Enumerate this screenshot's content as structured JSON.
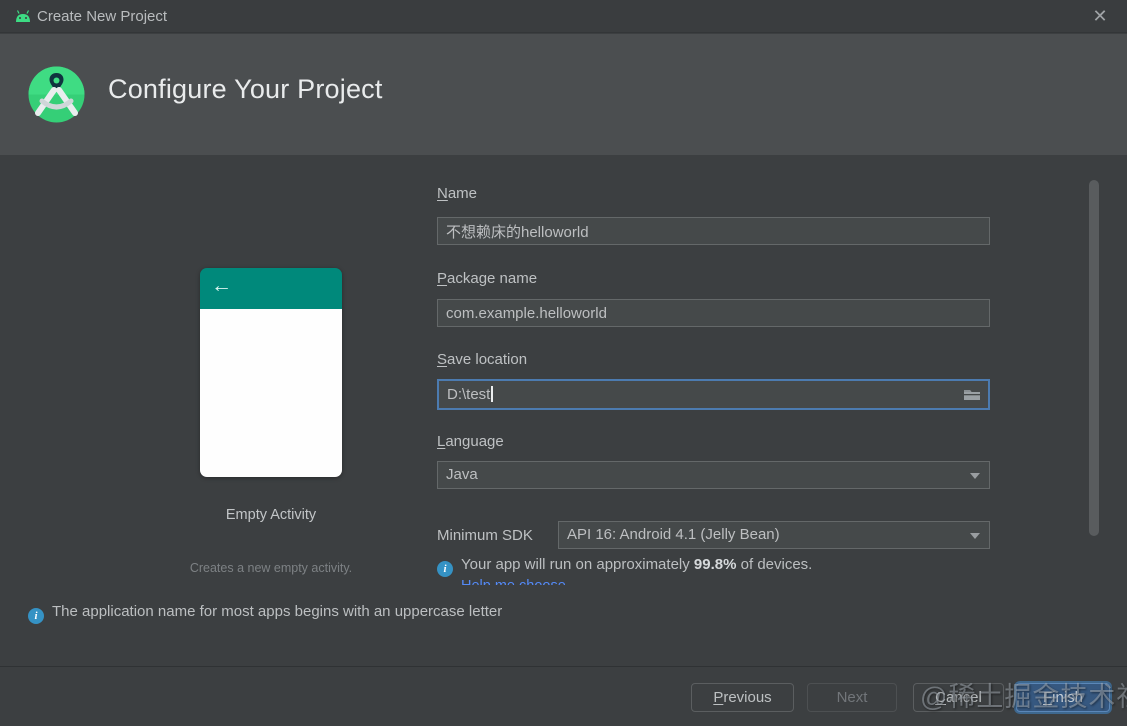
{
  "window": {
    "title": "Create New Project",
    "close_glyph": "✕"
  },
  "header": {
    "title": "Configure Your Project"
  },
  "template_preview": {
    "back_arrow": "←",
    "name": "Empty Activity",
    "description": "Creates a new empty activity."
  },
  "form": {
    "name": {
      "mnemonic": "N",
      "rest": "ame",
      "value": "不想赖床的helloworld"
    },
    "package": {
      "mnemonic": "P",
      "rest": "ackage name",
      "value": "com.example.helloworld"
    },
    "save": {
      "mnemonic": "S",
      "rest": "ave location",
      "value": "D:\\test"
    },
    "language": {
      "mnemonic": "L",
      "rest": "anguage",
      "value": "Java"
    },
    "min_sdk": {
      "label": "Minimum SDK",
      "value": "API 16: Android 4.1 (Jelly Bean)"
    },
    "sdk_info": {
      "icon": "i",
      "prefix": "Your app will run on approximately ",
      "percent": "99.8%",
      "suffix": " of devices."
    },
    "help_link": "Help me choose"
  },
  "info_bar": {
    "icon": "i",
    "text": "The application name for most apps begins with an uppercase letter"
  },
  "buttons": {
    "previous": {
      "mnemonic": "P",
      "rest": "revious"
    },
    "next": {
      "label": "Next"
    },
    "cancel": {
      "mnemonic": "C",
      "rest": "ancel"
    },
    "finish": {
      "mnemonic": "F",
      "rest": "inish"
    }
  },
  "watermark": "@稀土掘金技术社区",
  "colors": {
    "appbar_teal": "#00897b",
    "android_green": "#3ddc84",
    "focus_blue": "#4c7bb0",
    "info_blue": "#3592c4",
    "link_blue": "#548af7",
    "finish_button_bg": "#365880",
    "header_band": "#4b4e50",
    "dialog_bg": "#3c3f41"
  }
}
